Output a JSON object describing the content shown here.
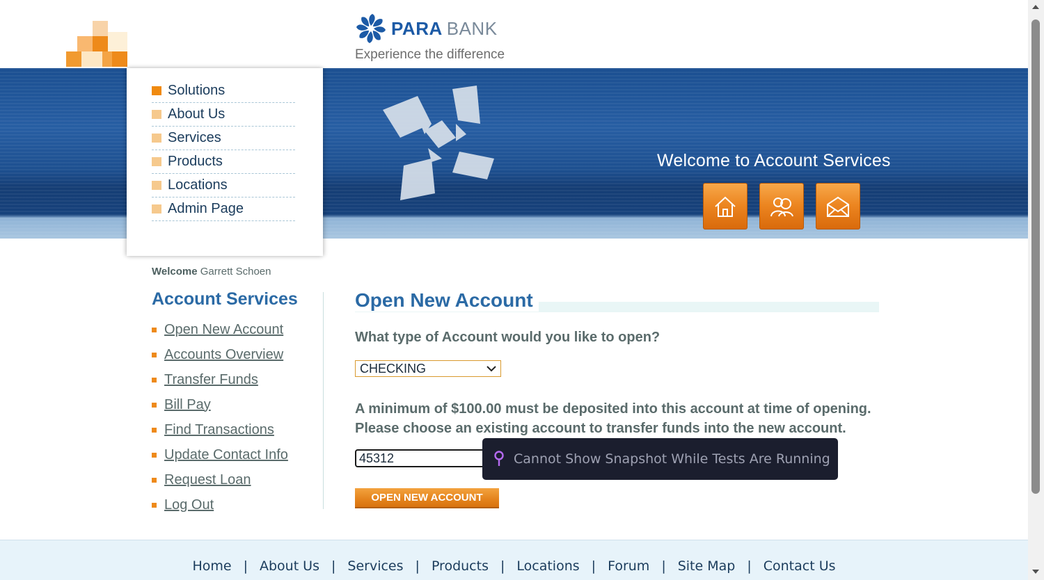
{
  "brand": {
    "name_part1": "PARA",
    "name_part2": "BANK",
    "tagline": "Experience the difference"
  },
  "banner": {
    "title": "Welcome to Account Services",
    "buttons": [
      {
        "icon": "home-icon"
      },
      {
        "icon": "contact-people-icon"
      },
      {
        "icon": "envelope-icon"
      }
    ]
  },
  "nav": {
    "items": [
      {
        "label": "Solutions",
        "active": true
      },
      {
        "label": "About Us"
      },
      {
        "label": "Services"
      },
      {
        "label": "Products"
      },
      {
        "label": "Locations"
      },
      {
        "label": "Admin Page"
      }
    ]
  },
  "user": {
    "welcome_label": "Welcome",
    "name": "Garrett Schoen"
  },
  "account_services": {
    "heading": "Account Services",
    "links": [
      "Open New Account",
      "Accounts Overview",
      "Transfer Funds",
      "Bill Pay",
      "Find Transactions",
      "Update Contact Info",
      "Request Loan",
      "Log Out"
    ]
  },
  "form": {
    "title": "Open New Account",
    "type_question": "What type of Account would you like to open?",
    "type_selected": "CHECKING",
    "min_deposit_line1": "A minimum of $100.00 must be deposited into this account at time of opening.",
    "min_deposit_line2": "Please choose an existing account to transfer funds into the new account.",
    "from_account_selected": "45312",
    "submit_label": "OPEN NEW ACCOUNT"
  },
  "overlay": {
    "message": "Cannot Show Snapshot While Tests Are Running",
    "icon": "pin-icon"
  },
  "footer": {
    "links": [
      "Home",
      "About Us",
      "Services",
      "Products",
      "Locations",
      "Forum",
      "Site Map",
      "Contact Us"
    ]
  },
  "colors": {
    "accent_orange": "#ec8520",
    "heading_blue": "#2b6aa5",
    "banner_blue": "#1b4f91",
    "toast_bg": "#1b1e2e"
  }
}
